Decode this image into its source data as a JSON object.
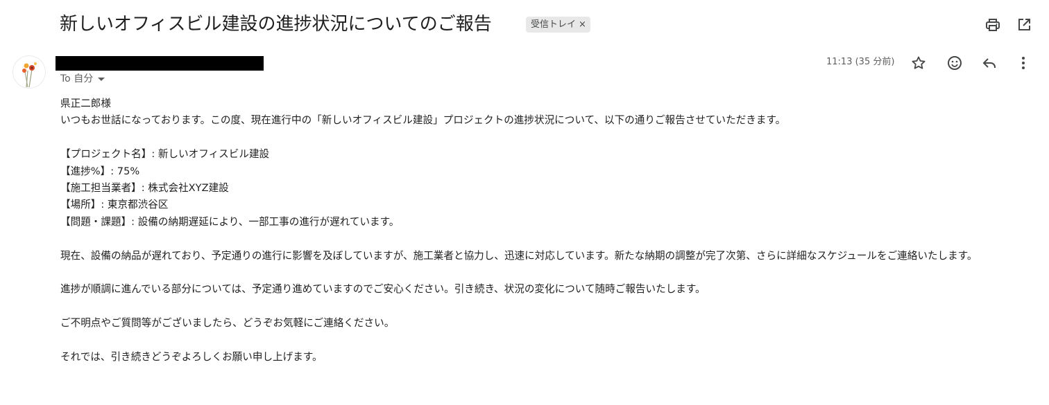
{
  "email": {
    "subject": "新しいオフィスビル建設の進捗状況についてのご報告",
    "label": "受信トレイ",
    "label_close": "×",
    "to_text": "To 自分",
    "time": "11:13 (35 分前)",
    "greeting": "県正二郎様",
    "intro": "いつもお世話になっております。この度、現在進行中の「新しいオフィスビル建設」プロジェクトの進捗状況について、以下の通りご報告させていただきます。",
    "details": [
      "【プロジェクト名】: 新しいオフィスビル建設",
      "【進捗%】: 75%",
      "【施工担当業者】: 株式会社XYZ建設",
      "【場所】: 東京都渋谷区",
      "【問題・課題】: 設備の納期遅延により、一部工事の進行が遅れています。"
    ],
    "para1": "現在、設備の納品が遅れており、予定通りの進行に影響を及ぼしていますが、施工業者と協力し、迅速に対応しています。新たな納期の調整が完了次第、さらに詳細なスケジュールをご連絡いたします。",
    "para2": "進捗が順調に進んでいる部分については、予定通り進めていますのでご安心ください。引き続き、状況の変化について随時ご報告いたします。",
    "para3": "ご不明点やご質問等がございましたら、どうぞお気軽にご連絡ください。",
    "closing": "それでは、引き続きどうぞよろしくお願い申し上げます。"
  },
  "icons": {
    "print": "print-icon",
    "open_new": "open-in-new-window-icon",
    "star": "star-icon",
    "emoji": "emoji-reaction-icon",
    "reply": "reply-icon",
    "more": "more-vertical-icon"
  }
}
